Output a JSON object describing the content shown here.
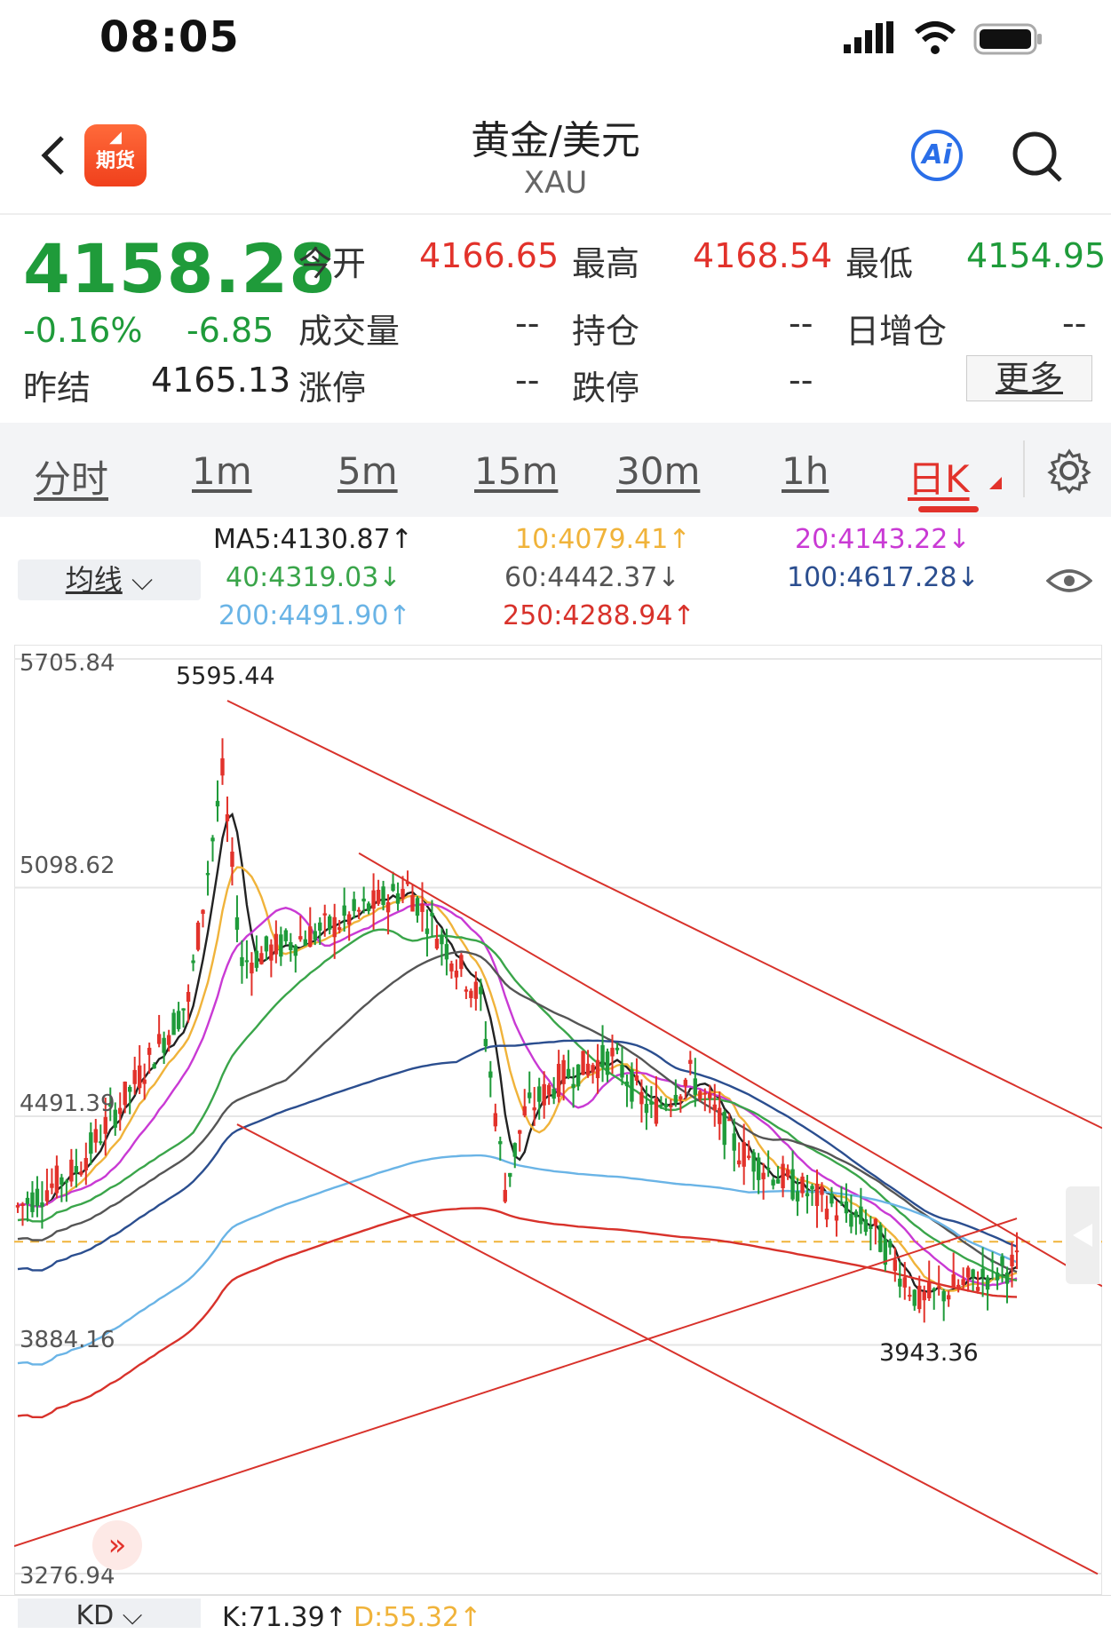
{
  "status_bar": {
    "time": "08:05"
  },
  "header": {
    "title": "黄金/美元",
    "subtitle": "XAU",
    "logo_text": "期货",
    "ai_label": "Ai"
  },
  "quote": {
    "last_price": "4158.28",
    "change_pct": "-0.16%",
    "change": "-6.85",
    "prev_settle_label": "昨结",
    "prev_settle": "4165.13",
    "open_label": "今开",
    "open": "4166.65",
    "high_label": "最高",
    "high": "4168.54",
    "low_label": "最低",
    "low": "4154.95",
    "volume_label": "成交量",
    "volume": "--",
    "oi_label": "持仓",
    "oi": "--",
    "oi_change_label": "日增仓",
    "oi_change": "--",
    "limit_up_label": "涨停",
    "limit_up": "--",
    "limit_down_label": "跌停",
    "limit_down": "--",
    "more_label": "更多"
  },
  "tabs": [
    {
      "label": "分时",
      "active": false
    },
    {
      "label": "1m",
      "active": false
    },
    {
      "label": "5m",
      "active": false
    },
    {
      "label": "15m",
      "active": false
    },
    {
      "label": "30m",
      "active": false
    },
    {
      "label": "1h",
      "active": false
    },
    {
      "label": "日K",
      "active": true
    }
  ],
  "ma_selector": {
    "label": "均线"
  },
  "ma_values": [
    {
      "text": "MA5:4130.87↑",
      "color": "#222222"
    },
    {
      "text": "10:4079.41↑",
      "color": "#f0b33a"
    },
    {
      "text": "20:4143.22↓",
      "color": "#c93ad4"
    },
    {
      "text": "40:4319.03↓",
      "color": "#3aa54a"
    },
    {
      "text": "60:4442.37↓",
      "color": "#555555"
    },
    {
      "text": "100:4617.28↓",
      "color": "#2b4e8f"
    },
    {
      "text": "200:4491.90↑",
      "color": "#6ab4e6"
    },
    {
      "text": "250:4288.94↑",
      "color": "#d8322b"
    }
  ],
  "chart_data": {
    "type": "candlestick",
    "y_tick_labels": [
      "5705.84",
      "5098.62",
      "4491.39",
      "3884.16",
      "3276.94"
    ],
    "ylim": [
      3276.94,
      5705.84
    ],
    "max_label": "5595.44",
    "min_label": "3943.36",
    "grid": true,
    "note_colors": {
      "up": "#e2322b",
      "down": "#1f9b3a"
    }
  },
  "indicator": {
    "selector_label": "KD",
    "k": "K:71.39↑",
    "d": "D:55.32↑"
  },
  "colors": {
    "up": "#e2322b",
    "down": "#1f9b3a",
    "accent": "#e2322b"
  }
}
